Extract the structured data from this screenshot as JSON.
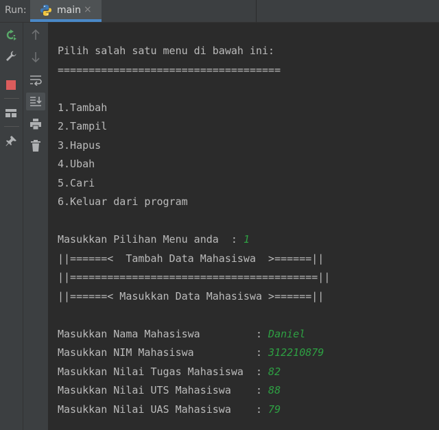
{
  "run_panel": {
    "label": "Run:",
    "tab": {
      "label": "main",
      "close_glyph": "×",
      "icon": "python-icon"
    }
  },
  "toolbar_left": [
    {
      "name": "rerun-icon",
      "color": "#59a869"
    },
    {
      "name": "wrench-icon",
      "color": "#afb1b3"
    },
    {
      "name": "stop-icon",
      "color": "#db5c5c"
    },
    {
      "name": "layout-icon",
      "color": "#afb1b3"
    },
    {
      "name": "pin-icon",
      "color": "#afb1b3"
    }
  ],
  "toolbar_right": [
    {
      "name": "up-arrow-icon"
    },
    {
      "name": "down-arrow-icon"
    },
    {
      "name": "soft-wrap-icon"
    },
    {
      "name": "scroll-to-end-icon"
    },
    {
      "name": "print-icon"
    },
    {
      "name": "trash-icon"
    }
  ],
  "console": {
    "lines": [
      {
        "text": "Pilih salah satu menu di bawah ini:"
      },
      {
        "text": "===================================="
      },
      {
        "text": ""
      },
      {
        "text": "1.Tambah"
      },
      {
        "text": "2.Tampil"
      },
      {
        "text": "3.Hapus"
      },
      {
        "text": "4.Ubah"
      },
      {
        "text": "5.Cari"
      },
      {
        "text": "6.Keluar dari program"
      },
      {
        "text": ""
      },
      {
        "text": "Masukkan Pilihan Menu anda  : ",
        "input": "1"
      },
      {
        "text": "||======<  Tambah Data Mahasiswa  >======||"
      },
      {
        "text": "||========================================||"
      },
      {
        "text": "||======< Masukkan Data Mahasiswa >======||"
      },
      {
        "text": ""
      },
      {
        "text": "Masukkan Nama Mahasiswa         : ",
        "input": "Daniel"
      },
      {
        "text": "Masukkan NIM Mahasiswa          : ",
        "input": "312210879"
      },
      {
        "text": "Masukkan Nilai Tugas Mahasiswa  : ",
        "input": "82"
      },
      {
        "text": "Masukkan Nilai UTS Mahasiswa    : ",
        "input": "88"
      },
      {
        "text": "Masukkan Nilai UAS Mahasiswa    : ",
        "input": "79"
      }
    ]
  }
}
